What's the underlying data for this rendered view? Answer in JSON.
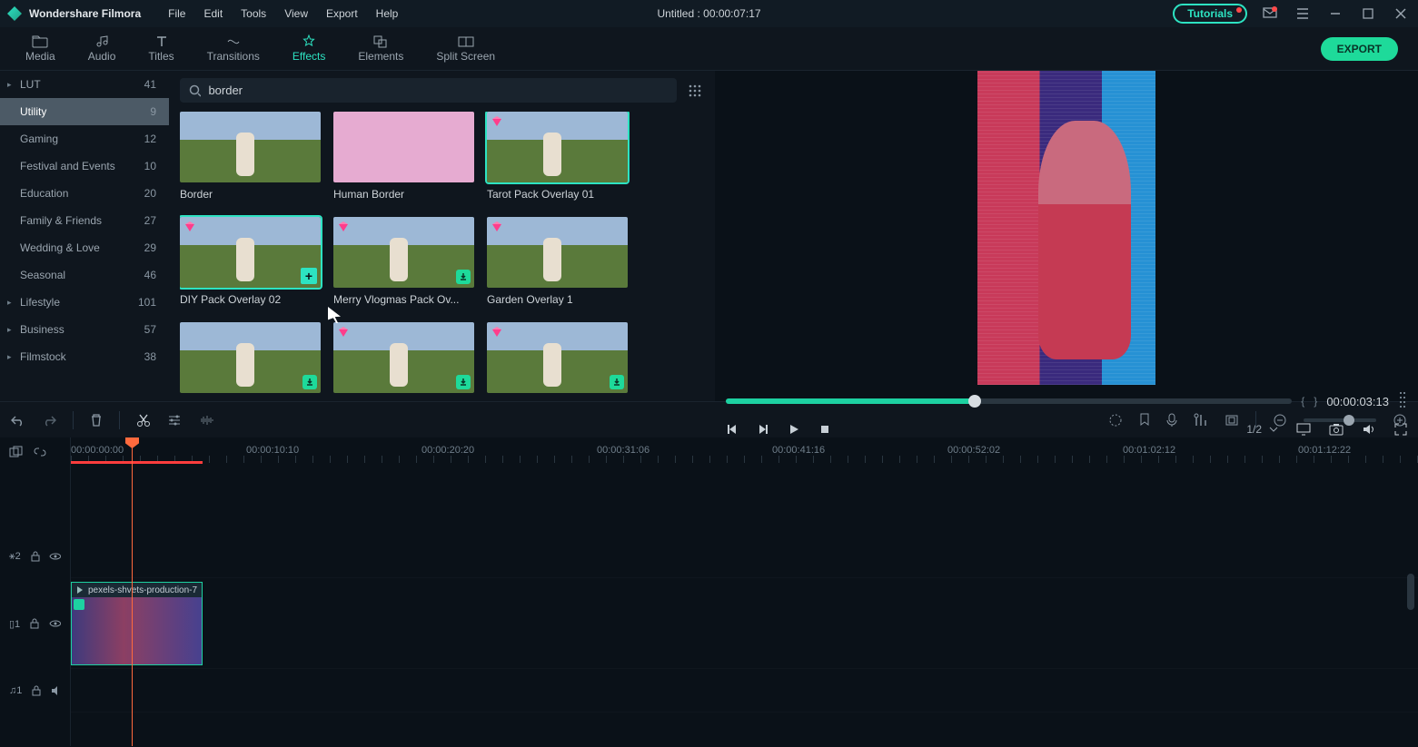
{
  "app": {
    "name": "Wondershare Filmora",
    "doc_title": "Untitled : 00:00:07:17",
    "tutorials": "Tutorials"
  },
  "menu": [
    "File",
    "Edit",
    "Tools",
    "View",
    "Export",
    "Help"
  ],
  "tabs": [
    {
      "label": "Media"
    },
    {
      "label": "Audio"
    },
    {
      "label": "Titles"
    },
    {
      "label": "Transitions"
    },
    {
      "label": "Effects",
      "active": true
    },
    {
      "label": "Elements"
    },
    {
      "label": "Split Screen"
    }
  ],
  "export_btn": "EXPORT",
  "sidebar": [
    {
      "label": "LUT",
      "count": 41,
      "top": true
    },
    {
      "label": "Utility",
      "count": 9,
      "active": true
    },
    {
      "label": "Gaming",
      "count": 12
    },
    {
      "label": "Festival and Events",
      "count": 10
    },
    {
      "label": "Education",
      "count": 20
    },
    {
      "label": "Family & Friends",
      "count": 27
    },
    {
      "label": "Wedding & Love",
      "count": 29
    },
    {
      "label": " Seasonal",
      "count": 46
    },
    {
      "label": "Lifestyle",
      "count": 101,
      "top": true
    },
    {
      "label": "Business",
      "count": 57,
      "top": true
    },
    {
      "label": "Filmstock",
      "count": 38,
      "top": true
    }
  ],
  "search": {
    "value": "border"
  },
  "thumbs": [
    {
      "label": "Border",
      "img": "vineyard",
      "gem": false
    },
    {
      "label": "Human Border",
      "img": "pink",
      "gem": false
    },
    {
      "label": "Tarot Pack Overlay 01",
      "img": "vineyard",
      "gem": true,
      "selected": true
    },
    {
      "label": "DIY Pack Overlay 02",
      "img": "vineyard",
      "gem": true,
      "selected": true,
      "add": true
    },
    {
      "label": "Merry Vlogmas Pack Ov...",
      "img": "vineyard",
      "gem": true,
      "dl": true
    },
    {
      "label": "Garden Overlay 1",
      "img": "vineyard",
      "gem": true
    },
    {
      "label": "",
      "img": "vineyard",
      "gem": false,
      "dl": true
    },
    {
      "label": "",
      "img": "vineyard",
      "gem": true,
      "dl": true
    },
    {
      "label": "",
      "img": "vineyard",
      "gem": true,
      "dl": true
    }
  ],
  "preview": {
    "progress_pct": 44,
    "left_brace": "{",
    "right_brace": "}",
    "timecode": "00:00:03:13",
    "ratio": "1/2"
  },
  "ruler": [
    "00:00:00:00",
    "00:00:10:10",
    "00:00:20:20",
    "00:00:31:06",
    "00:00:41:16",
    "00:00:52:02",
    "00:01:02:12",
    "00:01:12:22"
  ],
  "tracks": {
    "fx": "⚹2",
    "video": "▯1",
    "audio": "♫1"
  },
  "clip": {
    "name": "pexels-shvets-production-7"
  }
}
